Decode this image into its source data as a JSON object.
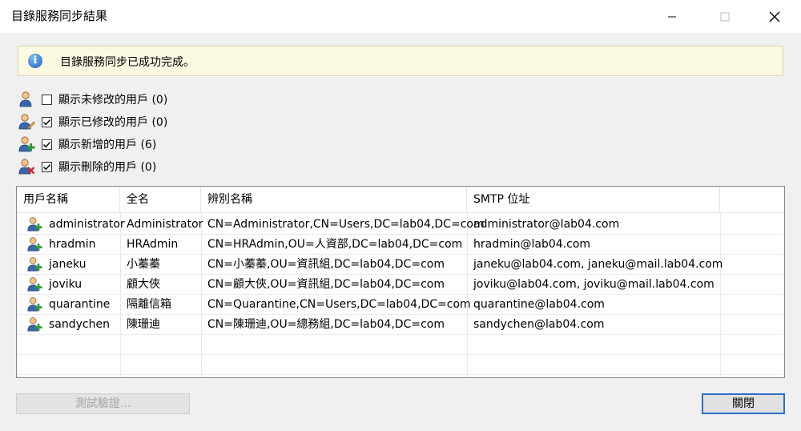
{
  "window": {
    "title": "目錄服務同步結果"
  },
  "info": {
    "message": "目錄服務同步已成功完成。"
  },
  "filters": [
    {
      "label": "顯示未修改的用戶 (0)",
      "checked": false,
      "icon": "user-icon"
    },
    {
      "label": "顯示已修改的用戶 (0)",
      "checked": true,
      "icon": "user-edit-icon"
    },
    {
      "label": "顯示新增的用戶 (6)",
      "checked": true,
      "icon": "user-add-icon"
    },
    {
      "label": "顯示刪除的用戶 (0)",
      "checked": true,
      "icon": "user-delete-icon"
    }
  ],
  "table": {
    "columns": [
      "用戶名稱",
      "全名",
      "辨別名稱",
      "SMTP 位址"
    ],
    "rows": [
      {
        "username": "administrator",
        "fullname": "Administrator",
        "dn": "CN=Administrator,CN=Users,DC=lab04,DC=com",
        "smtp": "administrator@lab04.com"
      },
      {
        "username": "hradmin",
        "fullname": "HRAdmin",
        "dn": "CN=HRAdmin,OU=人資部,DC=lab04,DC=com",
        "smtp": "hradmin@lab04.com"
      },
      {
        "username": "janeku",
        "fullname": "小蓁蓁",
        "dn": "CN=小蓁蓁,OU=資訊組,DC=lab04,DC=com",
        "smtp": "janeku@lab04.com, janeku@mail.lab04.com"
      },
      {
        "username": "joviku",
        "fullname": "顧大俠",
        "dn": "CN=顧大俠,OU=資訊組,DC=lab04,DC=com",
        "smtp": "joviku@lab04.com, joviku@mail.lab04.com"
      },
      {
        "username": "quarantine",
        "fullname": "隔離信箱",
        "dn": "CN=Quarantine,CN=Users,DC=lab04,DC=com",
        "smtp": "quarantine@lab04.com"
      },
      {
        "username": "sandychen",
        "fullname": "陳珊迪",
        "dn": "CN=陳珊迪,OU=總務組,DC=lab04,DC=com",
        "smtp": "sandychen@lab04.com"
      }
    ]
  },
  "buttons": {
    "test": "測試驗證...",
    "close": "關閉"
  },
  "colors": {
    "accent": "#2c6fc9",
    "info_bg": "#fcf9e2"
  }
}
